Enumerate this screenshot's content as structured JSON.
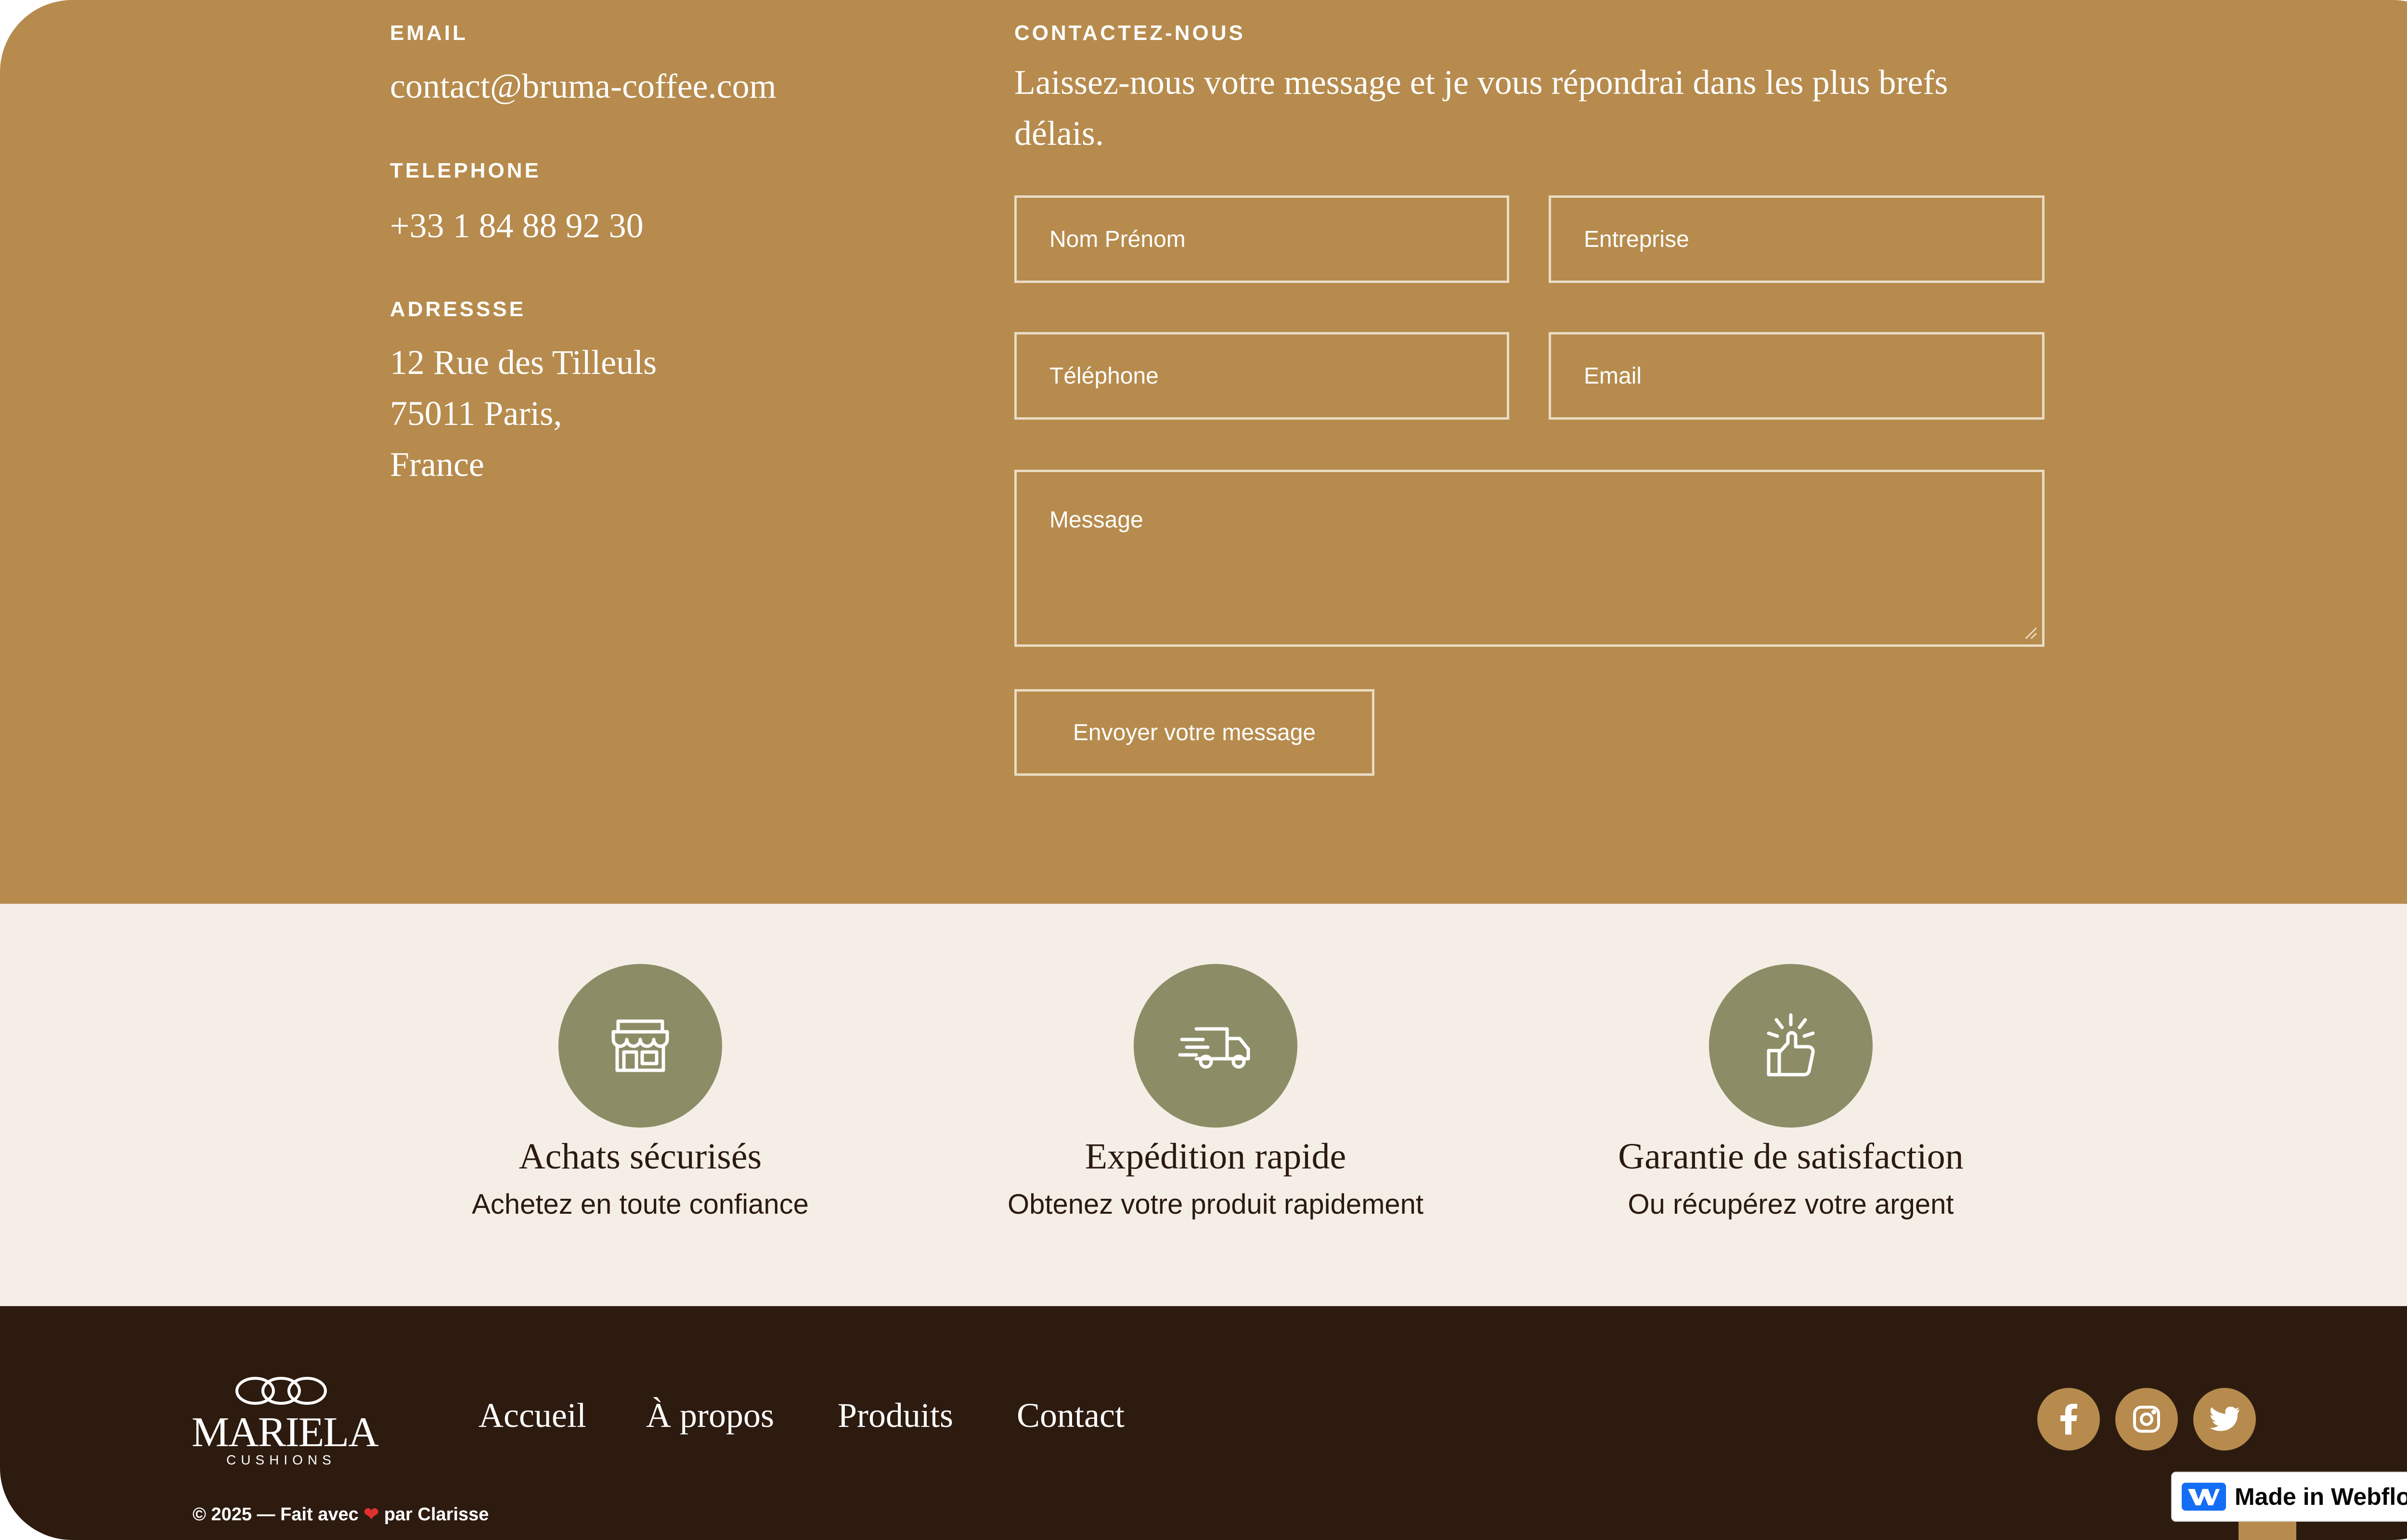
{
  "contact_info": {
    "email_label": "EMAIL",
    "email_value": "contact@bruma-coffee.com",
    "phone_label": "TELEPHONE",
    "phone_value": "+33 1 84 88 92 30",
    "address_label": "ADRESSSE",
    "address_lines": [
      "12 Rue des Tilleuls",
      "75011 Paris,",
      "France"
    ]
  },
  "contact_form": {
    "heading": "CONTACTEZ-NOUS",
    "intro": "Laissez-nous votre message et je vous répondrai dans les plus brefs délais.",
    "name_placeholder": "Nom Prénom",
    "company_placeholder": "Entreprise",
    "phone_placeholder": "Téléphone",
    "email_placeholder": "Email",
    "message_placeholder": "Message",
    "submit_label": "Envoyer votre message"
  },
  "features": [
    {
      "icon": "store-icon",
      "title": "Achats sécurisés",
      "subtitle": "Achetez en toute confiance"
    },
    {
      "icon": "delivery-truck-icon",
      "title": "Expédition rapide",
      "subtitle": "Obtenez votre produit rapidement"
    },
    {
      "icon": "thumbs-up-icon",
      "title": "Garantie de satisfaction",
      "subtitle": "Ou récupérez votre argent"
    }
  ],
  "footer": {
    "logo_name": "MARIELA",
    "logo_tagline": "CUSHIONS",
    "nav": [
      "Accueil",
      "À propos",
      "Produits",
      "Contact"
    ],
    "social_icons": [
      "facebook-icon",
      "instagram-icon",
      "twitter-icon"
    ],
    "copyright_prefix": "© 2025 — Fait avec",
    "copyright_suffix": "par Clarisse",
    "badge_label": "Made in Webflow"
  },
  "colors": {
    "contact_bg": "#b68b4d",
    "features_bg": "#f5eee6",
    "feature_circle": "#8c8d66",
    "footer_bg": "#2d1b10",
    "text_dark": "#2b1a10",
    "webflow_blue": "#146ef5"
  }
}
